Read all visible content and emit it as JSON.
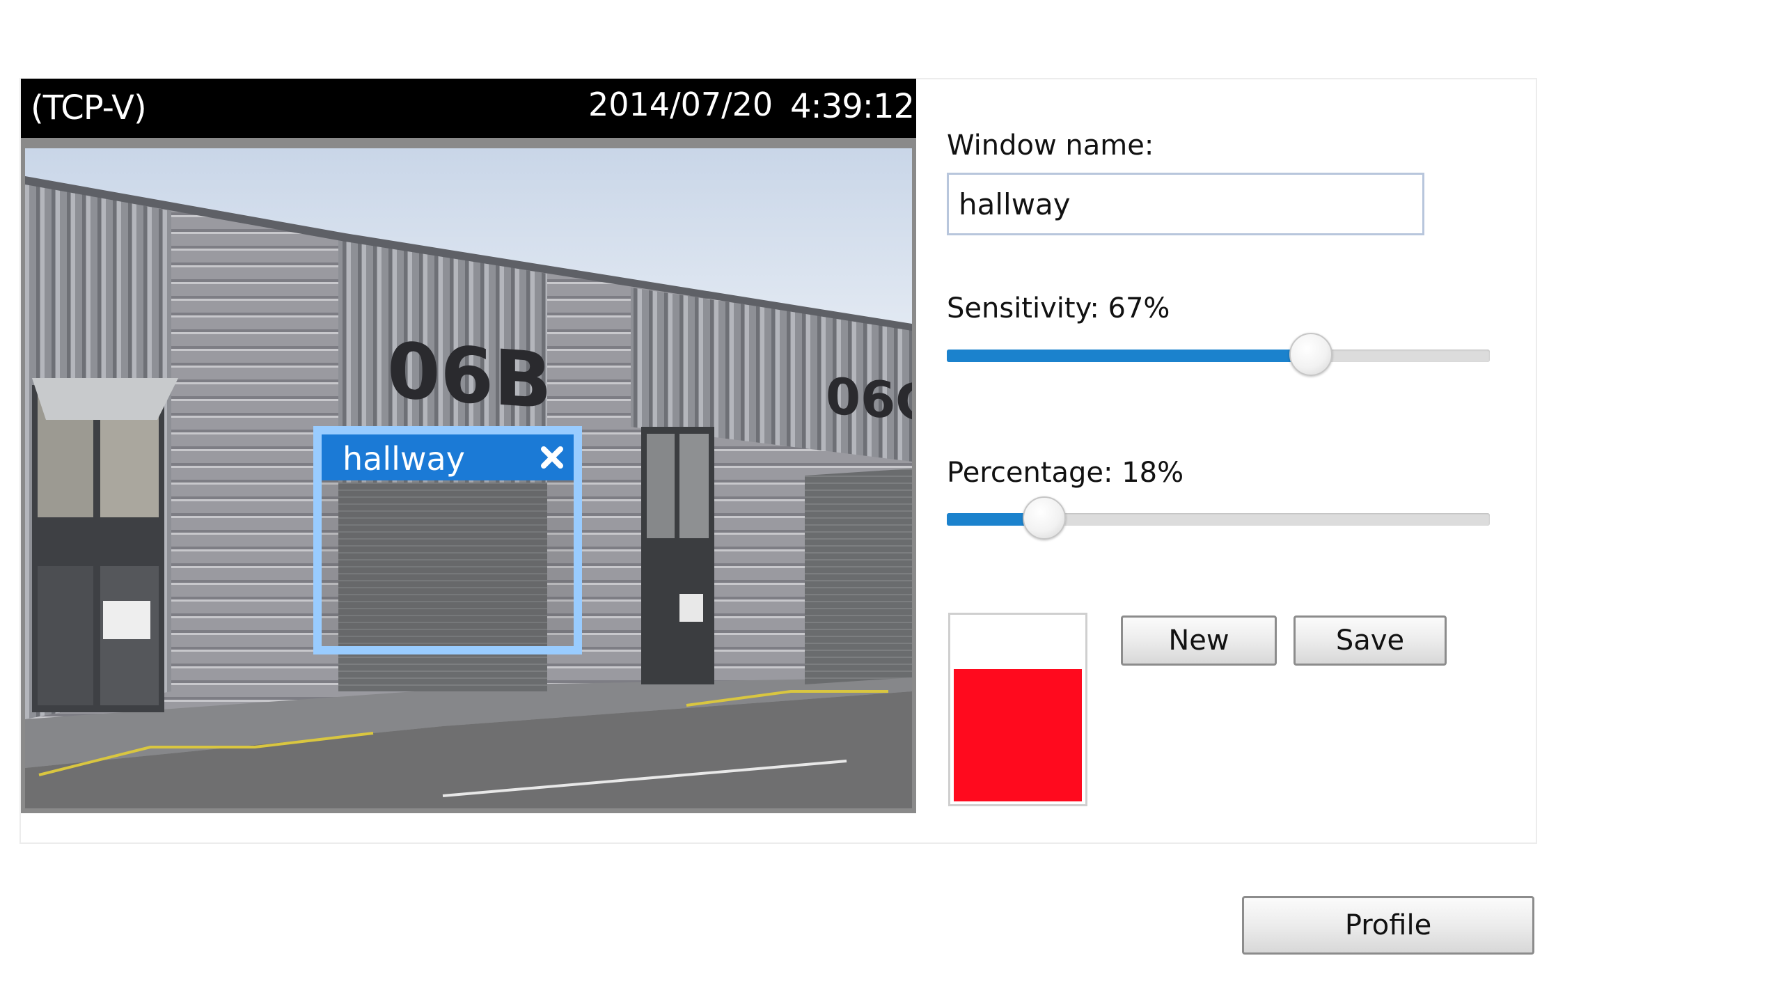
{
  "video": {
    "stream_label": "(TCP-V)",
    "date": "2014/07/20",
    "time": "4:39:12",
    "motion_window": {
      "label": "hallway",
      "close_icon": "close-icon"
    }
  },
  "settings": {
    "window_name_label": "Window name:",
    "window_name_value": "hallway",
    "sensitivity_label": "Sensitivity: 67%",
    "sensitivity_value": 67,
    "percentage_label": "Percentage: 18%",
    "percentage_value": 18,
    "alert_level_fraction": 0.7,
    "alert_level_color": "#ff0a1e"
  },
  "buttons": {
    "new": "New",
    "save": "Save",
    "profile": "Profile"
  }
}
